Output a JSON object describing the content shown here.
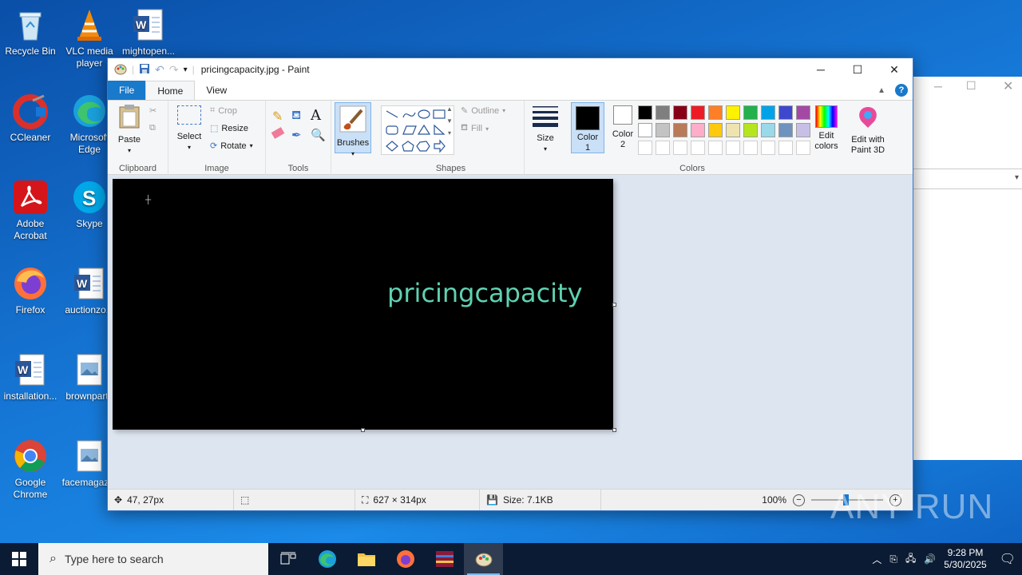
{
  "desktop": {
    "icons": [
      {
        "label": "Recycle Bin"
      },
      {
        "label": "VLC media player"
      },
      {
        "label": "mightopen..."
      },
      {
        "label": "CCleaner"
      },
      {
        "label": "Microsoft Edge"
      },
      {
        "label": "Adobe Acrobat"
      },
      {
        "label": "Skype"
      },
      {
        "label": "Firefox"
      },
      {
        "label": "auctionzo..."
      },
      {
        "label": "installation..."
      },
      {
        "label": "brownparty"
      },
      {
        "label": "Google Chrome"
      },
      {
        "label": "facemagaz..."
      }
    ]
  },
  "paint": {
    "title": "pricingcapacity.jpg - Paint",
    "tabs": {
      "file": "File",
      "home": "Home",
      "view": "View"
    },
    "clipboard": {
      "paste": "Paste",
      "group": "Clipboard"
    },
    "image": {
      "select": "Select",
      "crop": "Crop",
      "resize": "Resize",
      "rotate": "Rotate",
      "group": "Image"
    },
    "tools": {
      "group": "Tools"
    },
    "brushes": {
      "label": "Brushes"
    },
    "shapes": {
      "outline": "Outline",
      "fill": "Fill",
      "group": "Shapes"
    },
    "size": {
      "label": "Size"
    },
    "color1": {
      "label": "Color 1",
      "value": "#000000"
    },
    "color2": {
      "label": "Color 2",
      "value": "#ffffff"
    },
    "colors": {
      "group": "Colors",
      "edit": "Edit colors",
      "paint3d": "Edit with Paint 3D"
    },
    "palette": [
      "#000000",
      "#7f7f7f",
      "#880015",
      "#ed1c24",
      "#ff7f27",
      "#fff200",
      "#22b14c",
      "#00a2e8",
      "#3f48cc",
      "#a349a4",
      "#ffffff",
      "#c3c3c3",
      "#b97a57",
      "#ffaec9",
      "#ffc90e",
      "#efe4b0",
      "#b5e61d",
      "#99d9ea",
      "#7092be",
      "#c8bfe7"
    ],
    "canvas_text": "pricingcapacity",
    "status": {
      "cursor": "47, 27px",
      "dimensions": "627 × 314px",
      "size": "Size: 7.1KB",
      "zoom": "100%"
    }
  },
  "taskbar": {
    "search_placeholder": "Type here to search",
    "time": "9:28 PM",
    "date": "5/30/2025"
  },
  "watermark": "ANY RUN"
}
